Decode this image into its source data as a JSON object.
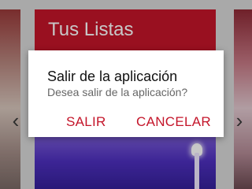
{
  "background": {
    "card_title": "Tus Listas",
    "nav": {
      "prev_icon": "chevron-left-icon",
      "next_icon": "chevron-right-icon"
    }
  },
  "dialog": {
    "title": "Salir de la aplicación",
    "message": "Desea salir de la aplicación?",
    "confirm_label": "SALIR",
    "cancel_label": "CANCELAR"
  },
  "colors": {
    "accent": "#c4152a",
    "dialog_bg": "#ffffff",
    "title_text": "#111111",
    "message_text": "#666666"
  }
}
